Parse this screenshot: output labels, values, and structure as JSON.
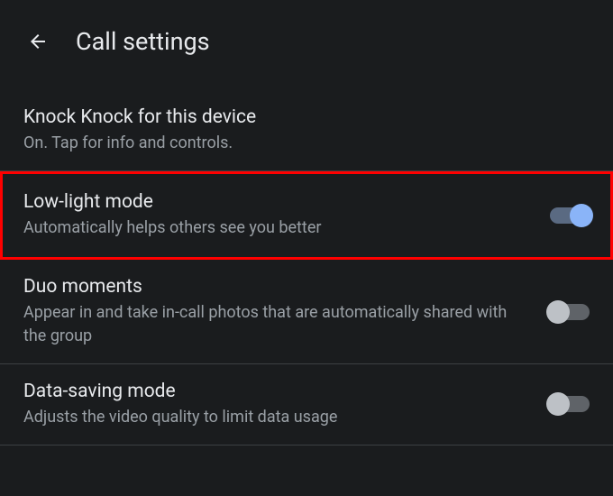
{
  "header": {
    "title": "Call settings"
  },
  "settings": [
    {
      "title": "Knock Knock for this device",
      "subtitle": "On. Tap for info and controls.",
      "hasToggle": false,
      "highlighted": false
    },
    {
      "title": "Low-light mode",
      "subtitle": "Automatically helps others see you better",
      "hasToggle": true,
      "toggleOn": true,
      "highlighted": true
    },
    {
      "title": "Duo moments",
      "subtitle": "Appear in and take in-call photos that are automatically shared with the group",
      "hasToggle": true,
      "toggleOn": false,
      "highlighted": false
    },
    {
      "title": "Data-saving mode",
      "subtitle": "Adjusts the video quality to limit data usage",
      "hasToggle": true,
      "toggleOn": false,
      "highlighted": false
    }
  ]
}
